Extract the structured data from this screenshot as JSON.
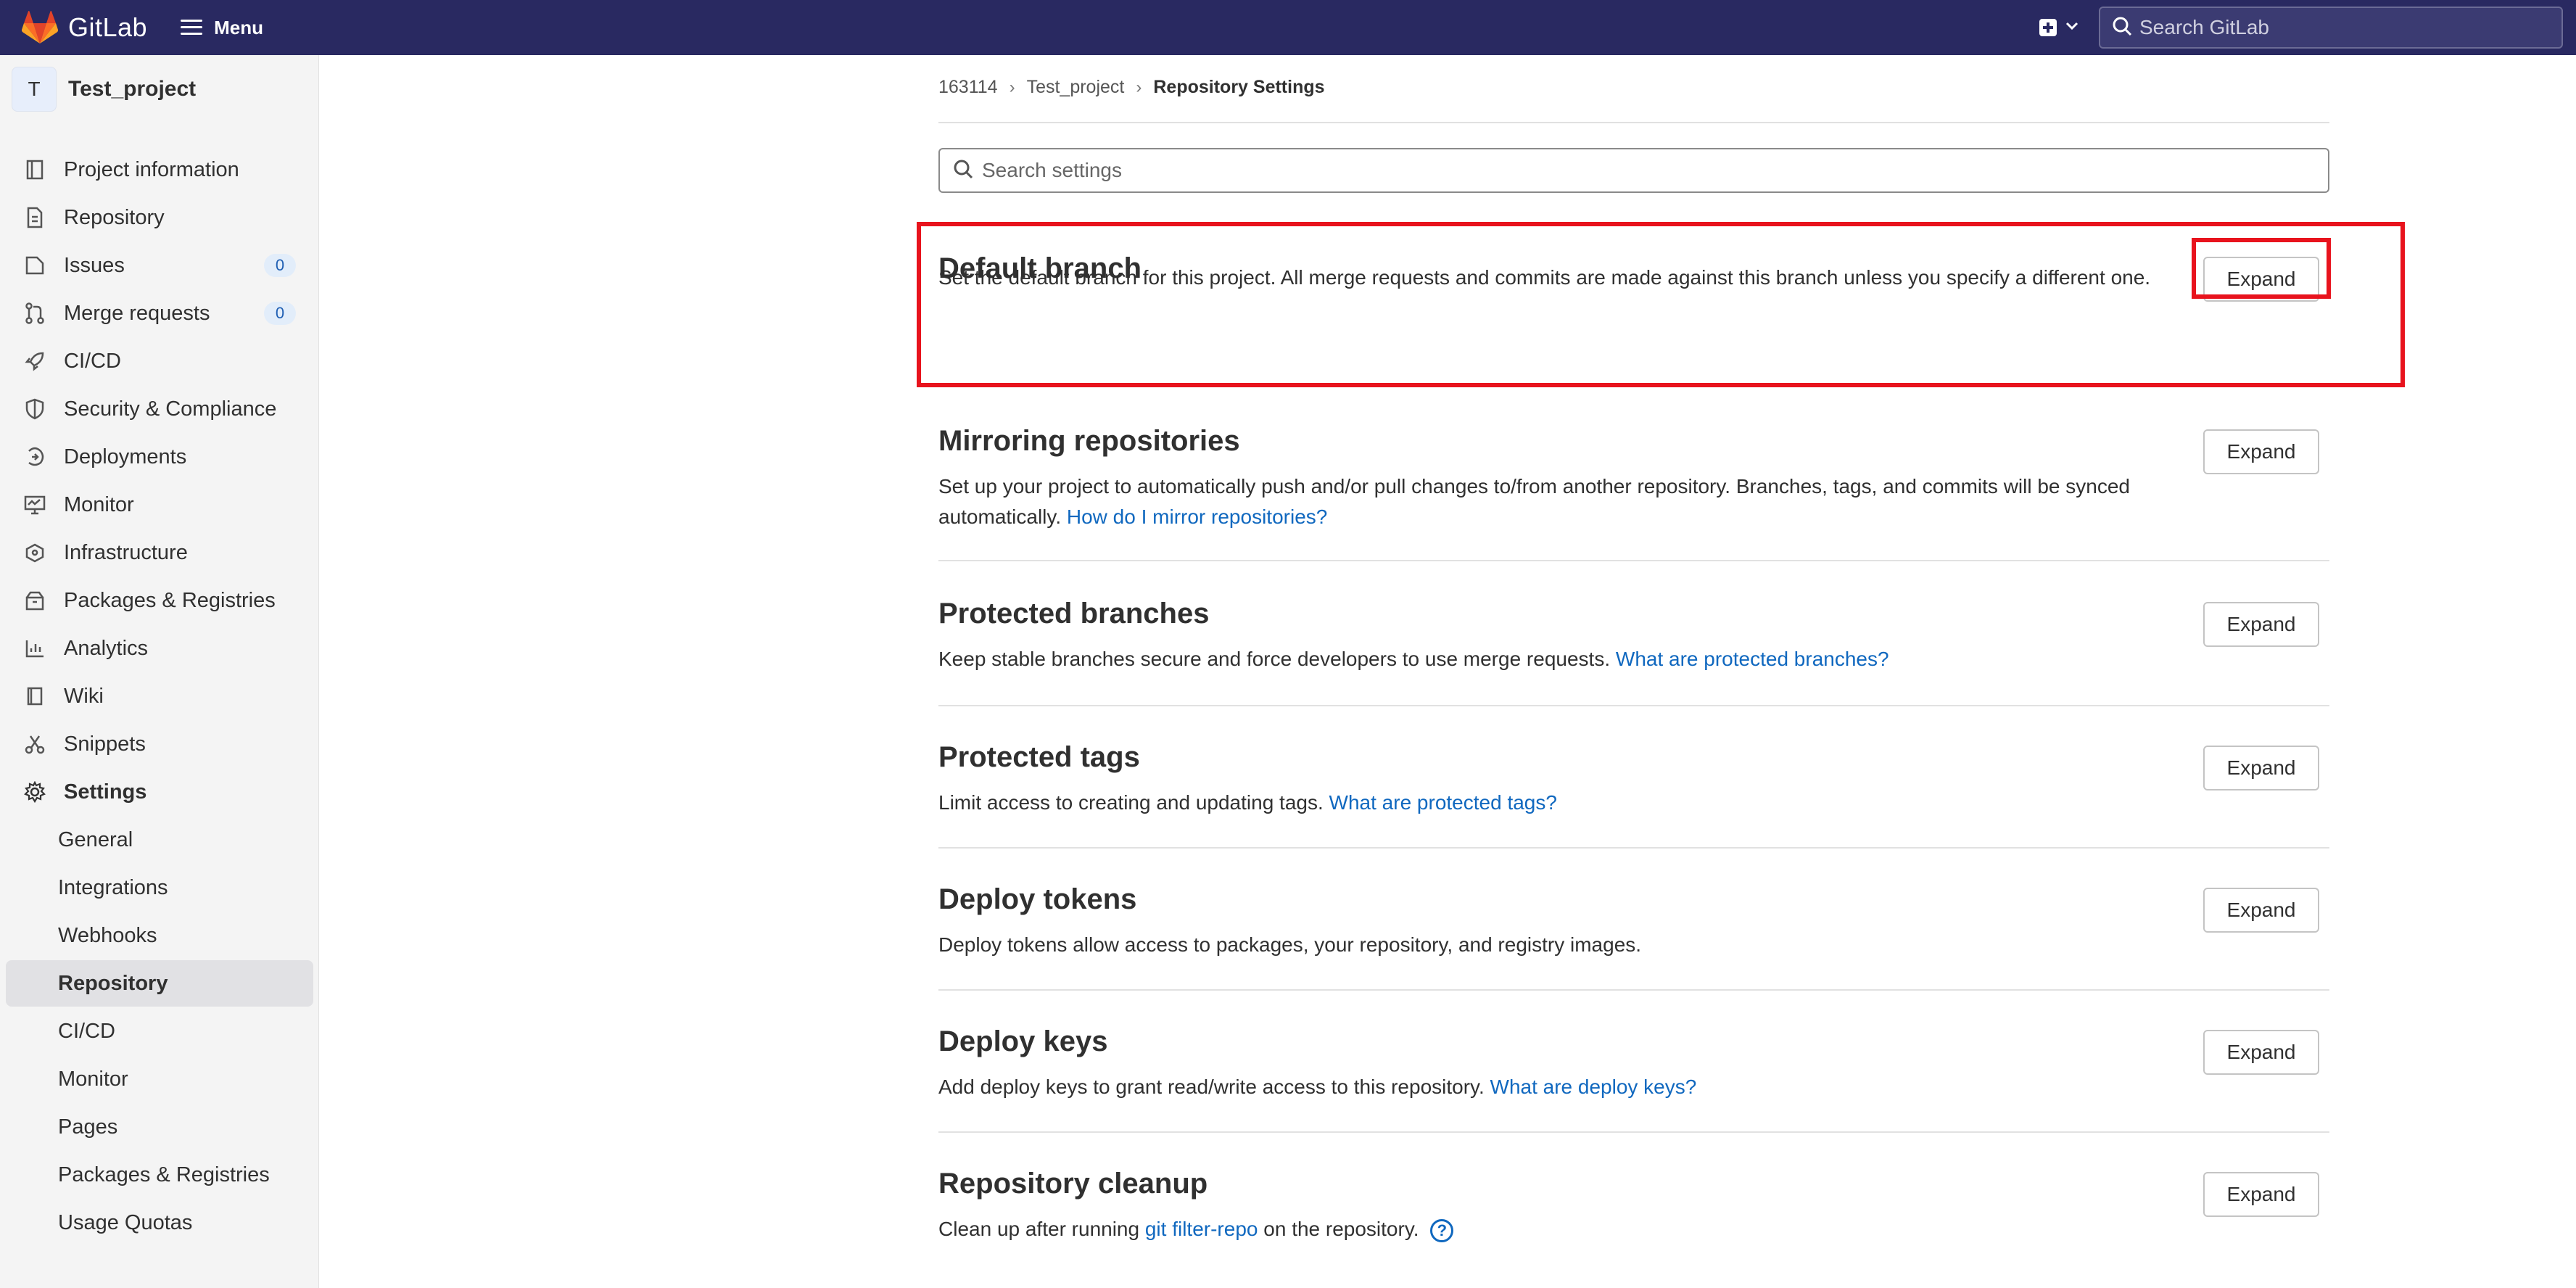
{
  "navbar": {
    "brand": "GitLab",
    "menu_label": "Menu",
    "search_placeholder": "Search GitLab"
  },
  "sidebar": {
    "project_initial": "T",
    "project_name": "Test_project",
    "items": [
      {
        "label": "Project information",
        "icon": "project-info-icon"
      },
      {
        "label": "Repository",
        "icon": "repository-icon"
      },
      {
        "label": "Issues",
        "icon": "issues-icon",
        "count": "0"
      },
      {
        "label": "Merge requests",
        "icon": "merge-request-icon",
        "count": "0"
      },
      {
        "label": "CI/CD",
        "icon": "rocket-icon"
      },
      {
        "label": "Security & Compliance",
        "icon": "shield-icon"
      },
      {
        "label": "Deployments",
        "icon": "deployments-icon"
      },
      {
        "label": "Monitor",
        "icon": "monitor-icon"
      },
      {
        "label": "Infrastructure",
        "icon": "cloud-icon"
      },
      {
        "label": "Packages & Registries",
        "icon": "package-icon"
      },
      {
        "label": "Analytics",
        "icon": "chart-icon"
      },
      {
        "label": "Wiki",
        "icon": "book-icon"
      },
      {
        "label": "Snippets",
        "icon": "snippet-icon"
      },
      {
        "label": "Settings",
        "icon": "gear-icon"
      }
    ],
    "settings_sub": [
      "General",
      "Integrations",
      "Webhooks",
      "Repository",
      "CI/CD",
      "Monitor",
      "Pages",
      "Packages & Registries",
      "Usage Quotas"
    ]
  },
  "breadcrumb": {
    "group": "163114",
    "project": "Test_project",
    "current": "Repository Settings"
  },
  "search": {
    "placeholder": "Search settings"
  },
  "expand_label": "Expand",
  "sections": [
    {
      "title": "Default branch",
      "desc": "Set the default branch for this project. All merge requests and commits are made against this branch unless you specify a different one.",
      "link": ""
    },
    {
      "title": "Mirroring repositories",
      "desc": "Set up your project to automatically push and/or pull changes to/from another repository. Branches, tags, and commits will be synced automatically.",
      "link": "How do I mirror repositories?"
    },
    {
      "title": "Protected branches",
      "desc": "Keep stable branches secure and force developers to use merge requests.",
      "link": "What are protected branches?"
    },
    {
      "title": "Protected tags",
      "desc": "Limit access to creating and updating tags.",
      "link": "What are protected tags?"
    },
    {
      "title": "Deploy tokens",
      "desc": "Deploy tokens allow access to packages, your repository, and registry images.",
      "link": ""
    },
    {
      "title": "Deploy keys",
      "desc": "Add deploy keys to grant read/write access to this repository.",
      "link": "What are deploy keys?"
    },
    {
      "title": "Repository cleanup",
      "desc_pre": "Clean up after running",
      "link": "git filter-repo",
      "desc_post": "on the repository."
    }
  ],
  "colors": {
    "navbar": "#292961",
    "link": "#1068bf",
    "highlight": "#e8131d"
  }
}
